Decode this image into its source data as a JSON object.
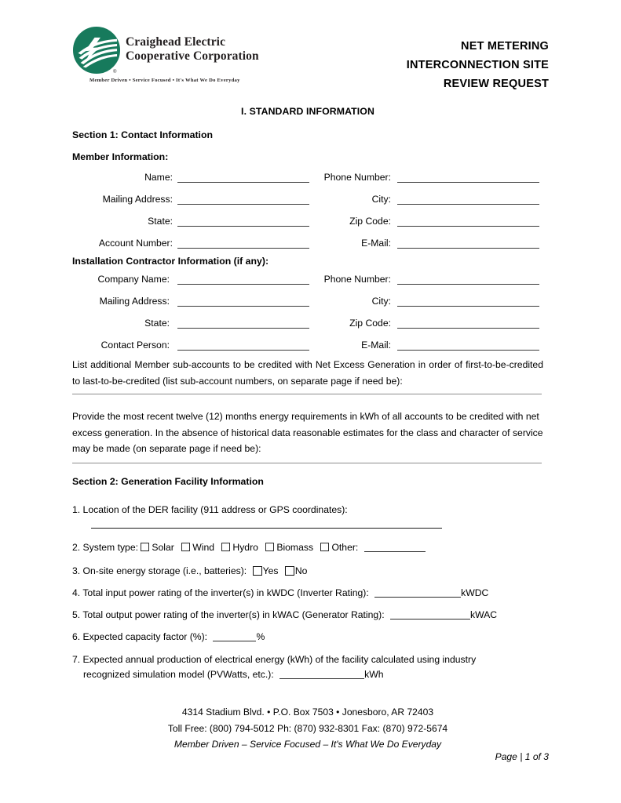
{
  "header": {
    "logo": {
      "icon": "craighead-electric-circle-logo",
      "wordmark_line1": "Craighead Electric",
      "wordmark_line2": "Cooperative Corporation",
      "registered_mark": "®",
      "tagline": "Member Driven • Service Focused • It's What We Do Everyday",
      "brand_green": "#177a5c"
    },
    "title_lines": [
      "NET METERING",
      "INTERCONNECTION SITE",
      "REVIEW REQUEST"
    ]
  },
  "standard_information_heading": "I. STANDARD INFORMATION",
  "section1": {
    "heading": "Section 1: Contact Information",
    "member_heading": "Member Information:",
    "member_fields": [
      {
        "left_label": "Name:",
        "right_label": "Phone Number:",
        "left_value": "",
        "right_value": ""
      },
      {
        "left_label": "Mailing Address:",
        "right_label": "City:",
        "left_value": "",
        "right_value": ""
      },
      {
        "left_label": "State:",
        "right_label": "Zip Code:",
        "left_value": "",
        "right_value": ""
      },
      {
        "left_label": "Account Number:",
        "right_label": "E-Mail:",
        "left_value": "",
        "right_value": ""
      }
    ],
    "contractor_heading": "Installation Contractor Information (if any):",
    "contractor_fields": [
      {
        "left_label": "Company Name:",
        "right_label": "Phone Number:",
        "left_value": "",
        "right_value": ""
      },
      {
        "left_label": "Mailing Address:",
        "right_label": "City:",
        "left_value": "",
        "right_value": ""
      },
      {
        "left_label": "State:",
        "right_label": "Zip Code:",
        "left_value": "",
        "right_value": ""
      },
      {
        "left_label": "Contact Person:",
        "right_label": "E-Mail:",
        "left_value": "",
        "right_value": ""
      }
    ],
    "sub_accounts_paragraph": "List additional Member sub-accounts to be credited with Net Excess Generation in order of first-to-be-credited to last-to-be-credited (list sub-account numbers, on separate page if need be):",
    "energy_requirements_paragraph": "Provide the most recent twelve (12) months energy requirements in kWh of all accounts to be credited with net excess generation. In the absence of historical data reasonable estimates for the class and character of service may be made (on separate page if need be):"
  },
  "section2": {
    "heading": "Section 2: Generation Facility Information",
    "q1": "1. Location of the DER facility (911 address or GPS coordinates):",
    "q1_answer": "",
    "q2_prefix": "2. System type:",
    "q2_options": [
      "Solar",
      "Wind",
      "Hydro",
      "Biomass"
    ],
    "q2_other_label": "Other:",
    "q2_other_value": "",
    "q3_prefix": "3. On-site energy storage (i.e., batteries):",
    "q3_options": [
      "Yes",
      "No"
    ],
    "q4": "4. Total input power rating of the inverter(s) in kWDC (Inverter Rating):",
    "q4_value": "",
    "q4_unit": "kWDC",
    "q5": "5. Total output power rating of the inverter(s) in kWAC (Generator Rating):",
    "q5_value": "",
    "q5_unit": "kWAC",
    "q6": "6. Expected capacity factor (%):",
    "q6_value": "",
    "q6_unit": "%",
    "q7_line1": "7. Expected annual production of electrical energy (kWh) of the facility calculated using industry",
    "q7_line2": "recognized simulation model (PVWatts, etc.):",
    "q7_value": "",
    "q7_unit": "kWh"
  },
  "footer": {
    "address_line": "4314 Stadium Blvd. • P.O. Box 7503 • Jonesboro, AR 72403",
    "phone_line": "Toll Free: (800) 794-5012 Ph: (870) 932-8301 Fax: (870) 972-5674",
    "tagline": "Member Driven – Service Focused – It's What We Do Everyday",
    "page_number": "Page | 1 of 3"
  }
}
